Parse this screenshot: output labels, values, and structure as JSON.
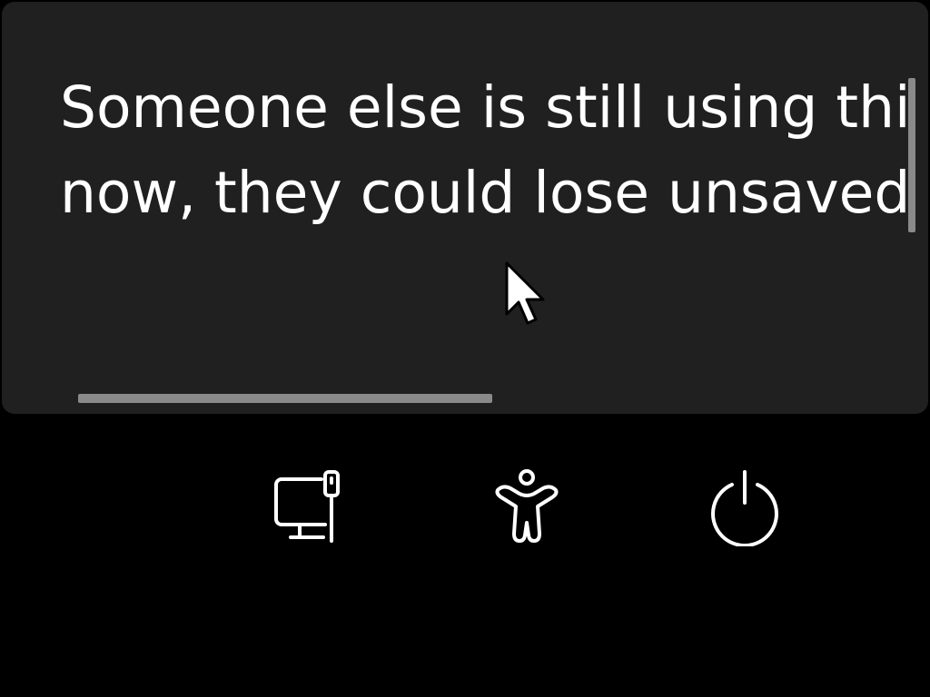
{
  "dialog": {
    "message_line1": "Someone else is still using this",
    "message_line2": "now, they could lose unsaved v"
  },
  "bottom_bar": {
    "buttons": [
      {
        "icon": "network-icon"
      },
      {
        "icon": "accessibility-icon"
      },
      {
        "icon": "power-icon"
      }
    ]
  },
  "colors": {
    "background": "#000000",
    "dialog_bg": "#202020",
    "text": "#ffffff",
    "scrollbar": "#8a8a8a"
  }
}
